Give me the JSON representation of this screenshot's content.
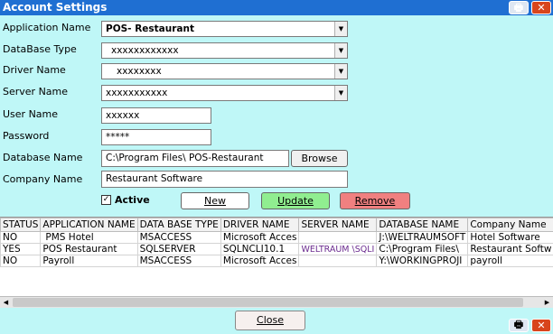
{
  "window": {
    "title": "Account Settings"
  },
  "form": {
    "labels": {
      "application_name": "Application Name",
      "database_type": "DataBase Type",
      "driver_name": "Driver Name",
      "server_name": "Server  Name",
      "user_name": "User Name",
      "password": "Password",
      "database_name": "Database  Name",
      "company_name": "Company Name"
    },
    "values": {
      "application_name": "POS- Restaurant",
      "database_type": "xxxxxxxxxxxx",
      "driver_name": "xxxxxxxx",
      "server_name": "xxxxxxxxxxx",
      "user_name": "xxxxxx",
      "password": "*****",
      "database_name": "C:\\Program Files\\  POS-Restaurant",
      "company_name": "Restaurant Software"
    },
    "active_label": "Active",
    "active_checked": true,
    "buttons": {
      "browse": "Browse",
      "new": "New",
      "update": "Update",
      "remove": "Remove",
      "close": "Close"
    }
  },
  "table": {
    "headers": [
      "STATUS",
      "APPLICATION NAME",
      "DATA BASE TYPE",
      "DRIVER NAME",
      "SERVER NAME",
      "DATABASE NAME",
      "Company Name"
    ],
    "rows": [
      [
        "NO",
        "PMS Hotel",
        "MSACCESS",
        "Microsoft Acces",
        "",
        "J:\\WELTRAUMSOFT",
        "Hotel Software"
      ],
      [
        "YES",
        "POS Restaurant",
        "SQLSERVER",
        "SQLNCLI10.1",
        "WELTRAUM \\SQLI",
        "C:\\Program Files\\",
        "Restaurant Softw"
      ],
      [
        "NO",
        "Payroll",
        "MSACCESS",
        "Microsoft Acces",
        "",
        "Y:\\WORKINGPROJI",
        "payroll"
      ]
    ]
  },
  "colors": {
    "background": "#bff7f7",
    "titlebar": "#1f6fd2",
    "new_button": "#ffffff",
    "update_button": "#90ee90",
    "remove_button": "#f08080"
  },
  "icons": {
    "print": "printer-icon",
    "close": "close-icon"
  }
}
